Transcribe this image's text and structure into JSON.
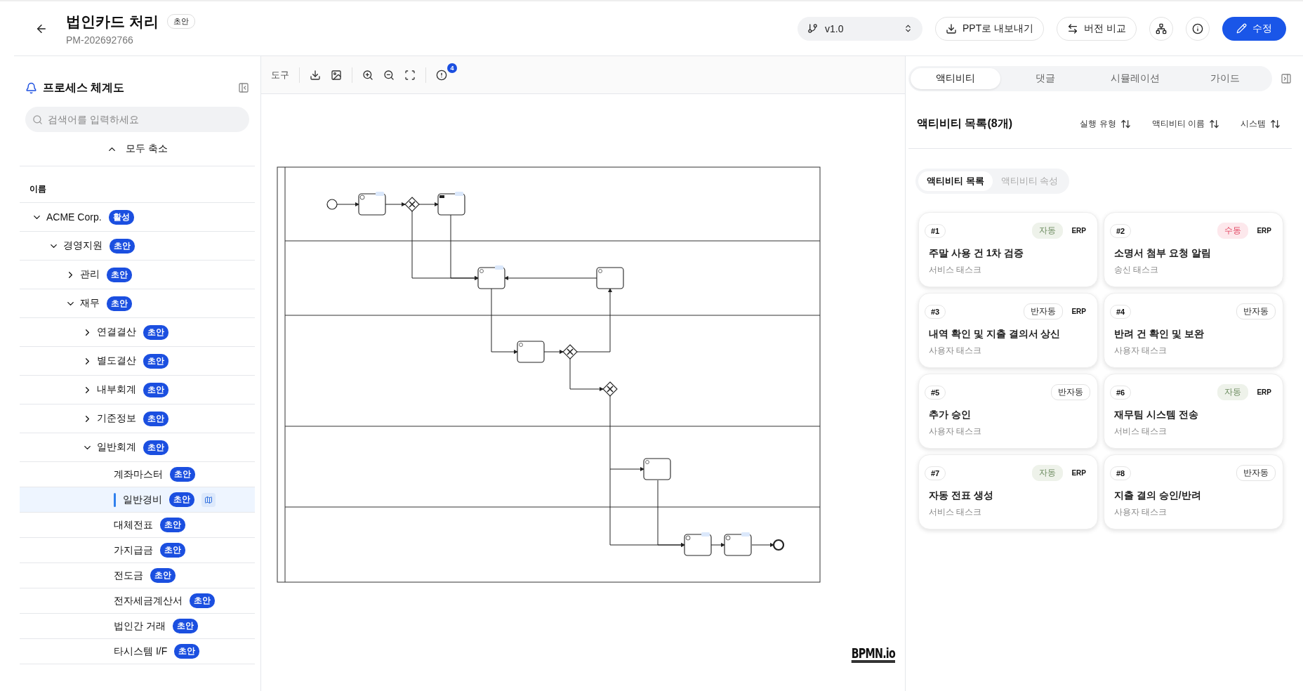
{
  "header": {
    "title": "법인카드 처리",
    "status": "초안",
    "code": "PM-202692766",
    "version": "v1.0",
    "buttons": [
      {
        "label": "PPT로 내보내기",
        "kind": "export"
      },
      {
        "label": "버전 비교",
        "kind": "compare"
      }
    ],
    "edit_button": "수정"
  },
  "sidebar": {
    "title": "프로세스 체계도",
    "search": {
      "placeholder": "검색어를 입력하세요"
    },
    "collapse_all": "모두 축소",
    "column": "이름",
    "tree": [
      {
        "label": "ACME Corp.",
        "badge": "활성",
        "expanded": true,
        "selected": false,
        "children": [
          {
            "label": "경영지원",
            "badge": "초안",
            "expanded": true,
            "selected": false,
            "children": [
              {
                "label": "관리",
                "badge": "초안",
                "expanded": false,
                "selected": false
              },
              {
                "label": "재무",
                "badge": "초안",
                "expanded": true,
                "selected": false,
                "children": [
                  {
                    "label": "연결결산",
                    "badge": "초안",
                    "expanded": false,
                    "selected": false
                  },
                  {
                    "label": "별도결산",
                    "badge": "초안",
                    "expanded": false,
                    "selected": false
                  },
                  {
                    "label": "내부회계",
                    "badge": "초안",
                    "expanded": false,
                    "selected": false
                  },
                  {
                    "label": "기준정보",
                    "badge": "초안",
                    "expanded": false,
                    "selected": false
                  },
                  {
                    "label": "일반회계",
                    "badge": "초안",
                    "expanded": true,
                    "selected": false,
                    "children": [
                      {
                        "label": "계좌마스터",
                        "badge": "초안",
                        "selected": false
                      },
                      {
                        "label": "일반경비",
                        "badge": "초안",
                        "selected": true
                      },
                      {
                        "label": "대체전표",
                        "badge": "초안",
                        "selected": false
                      },
                      {
                        "label": "가지급금",
                        "badge": "초안",
                        "selected": false
                      },
                      {
                        "label": "전도금",
                        "badge": "초안",
                        "selected": false
                      },
                      {
                        "label": "전자세금계산서",
                        "badge": "초안",
                        "selected": false
                      },
                      {
                        "label": "법인간 거래",
                        "badge": "초안",
                        "selected": false
                      },
                      {
                        "label": "타시스템 I/F",
                        "badge": "초안",
                        "selected": false
                      }
                    ]
                  }
                ]
              }
            ]
          }
        ]
      }
    ]
  },
  "toolbar": {
    "label": "도구",
    "notification_count": "4"
  },
  "diagram": {
    "watermark": "BPMN.io"
  },
  "panel": {
    "tabs": [
      {
        "label": "액티비티",
        "selected": true
      },
      {
        "label": "댓글",
        "selected": false
      },
      {
        "label": "시뮬레이션",
        "selected": false
      },
      {
        "label": "가이드",
        "selected": false
      }
    ],
    "title": "액티비티 목록(8개)",
    "sorts": [
      "실행 유형",
      "액티비티 이름",
      "시스템"
    ],
    "views": [
      {
        "label": "액티비티 목록",
        "selected": true
      },
      {
        "label": "액티비티 속성",
        "selected": false
      }
    ],
    "activities": [
      {
        "number": "#1",
        "mode": {
          "label": "자동",
          "kind": "auto"
        },
        "system": "ERP",
        "name": "주말 사용 건 1차 검증",
        "type": "서비스 태스크"
      },
      {
        "number": "#2",
        "mode": {
          "label": "수동",
          "kind": "manual"
        },
        "system": "ERP",
        "name": "소명서 첨부 요청 알림",
        "type": "송신 태스크"
      },
      {
        "number": "#3",
        "mode": {
          "label": "반자동",
          "kind": "semi"
        },
        "system": "ERP",
        "name": "내역 확인 및 지출 결의서 상신",
        "type": "사용자 태스크"
      },
      {
        "number": "#4",
        "mode": {
          "label": "반자동",
          "kind": "semi"
        },
        "name": "반려 건 확인 및 보완",
        "type": "사용자 태스크"
      },
      {
        "number": "#5",
        "mode": {
          "label": "반자동",
          "kind": "semi"
        },
        "name": "추가 승인",
        "type": "사용자 태스크"
      },
      {
        "number": "#6",
        "mode": {
          "label": "자동",
          "kind": "auto"
        },
        "system": "ERP",
        "name": "재무팀 시스템 전송",
        "type": "서비스 태스크"
      },
      {
        "number": "#7",
        "mode": {
          "label": "자동",
          "kind": "auto"
        },
        "system": "ERP",
        "name": "자동 전표 생성",
        "type": "서비스 태스크"
      },
      {
        "number": "#8",
        "mode": {
          "label": "반자동",
          "kind": "semi"
        },
        "name": "지출 결의 승인/반려",
        "type": "사용자 태스크"
      }
    ]
  }
}
